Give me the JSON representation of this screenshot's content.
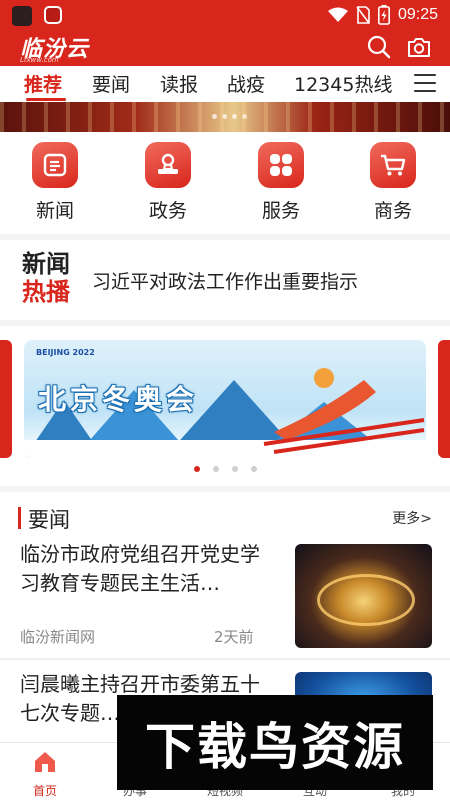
{
  "status_bar": {
    "time": "09:25"
  },
  "header": {
    "logo": "临汾云",
    "logo_sub": "Lfxww.com"
  },
  "tabs": [
    {
      "label": "推荐",
      "active": true
    },
    {
      "label": "要闻"
    },
    {
      "label": "读报"
    },
    {
      "label": "战疫"
    },
    {
      "label": "12345热线"
    }
  ],
  "quick_links": [
    {
      "label": "新闻",
      "icon": "document-icon"
    },
    {
      "label": "政务",
      "icon": "stamp-icon"
    },
    {
      "label": "服务",
      "icon": "grid-icon"
    },
    {
      "label": "商务",
      "icon": "cart-icon"
    }
  ],
  "hot_news": {
    "badge_line1": "新闻",
    "badge_line2": "热播",
    "headline": "习近平对政法工作作出重要指示"
  },
  "carousel": {
    "slide_title": "北京冬奥会",
    "slide_logo": "BEIJING 2022",
    "dots": 4,
    "active_dot": 0
  },
  "news_section": {
    "title": "要闻",
    "more": "更多>",
    "items": [
      {
        "title": "临汾市政府党组召开党史学习教育专题民主生活…",
        "source": "临汾新闻网",
        "time": "2天前"
      },
      {
        "title": "闫晨曦主持召开市委第五十七次专题…"
      }
    ]
  },
  "watermark": "下载鸟资源",
  "bottom_nav": [
    {
      "label": "首页",
      "active": true
    },
    {
      "label": "办事"
    },
    {
      "label": "短视频"
    },
    {
      "label": "互动"
    },
    {
      "label": "我的"
    }
  ],
  "colors": {
    "brand": "#d9261c"
  }
}
